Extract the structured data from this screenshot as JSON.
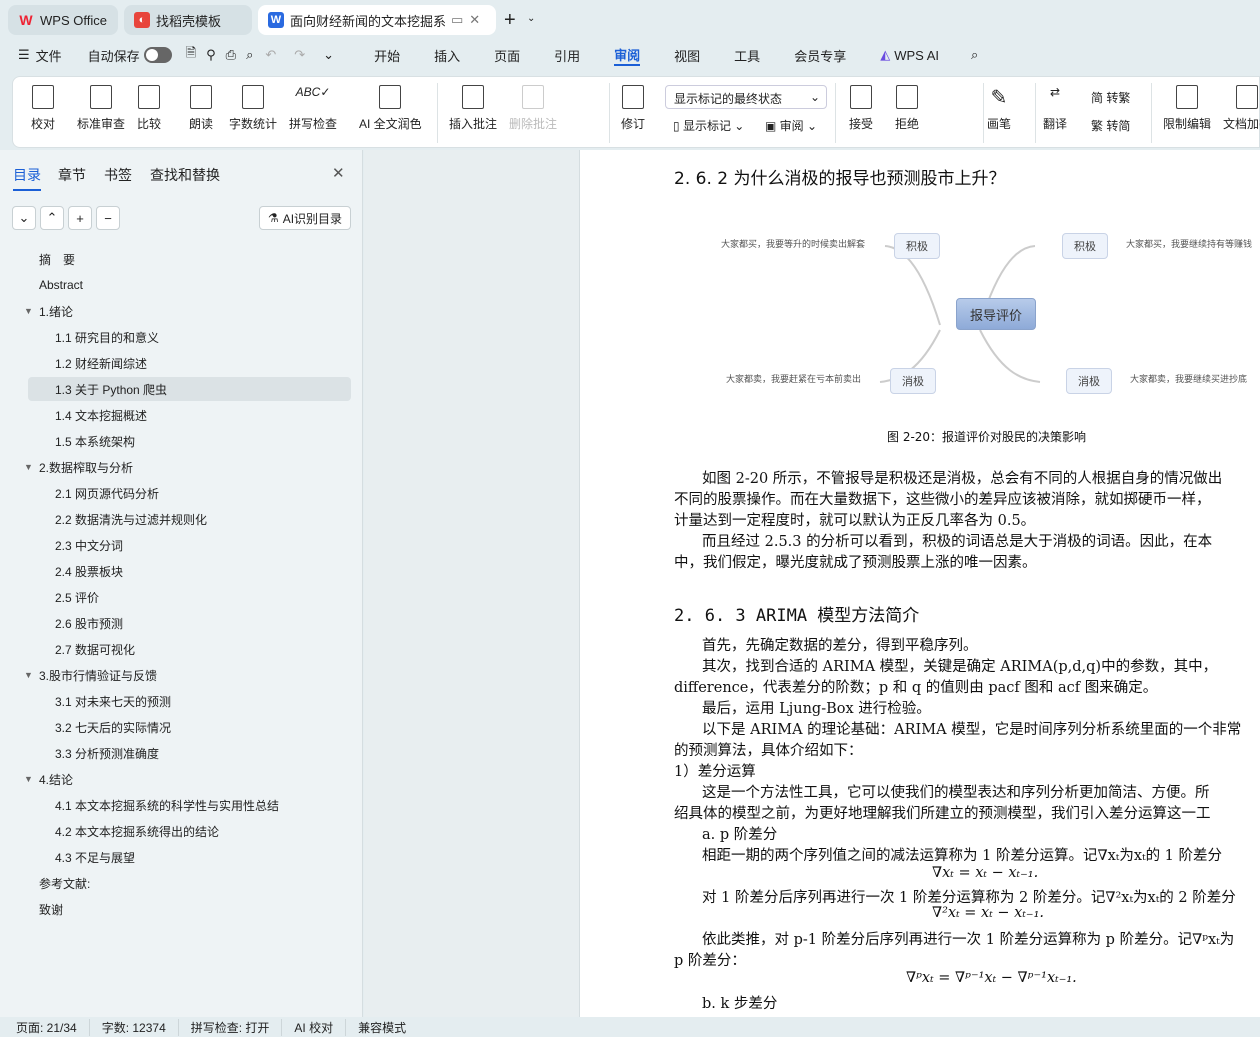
{
  "tabs": [
    {
      "label": "WPS Office"
    },
    {
      "label": "找稻壳模板"
    },
    {
      "label": "面向财经新闻的文本挖掘系统"
    }
  ],
  "menu": {
    "file": "文件",
    "autosave": "自动保存",
    "items": [
      "开始",
      "插入",
      "页面",
      "引用",
      "审阅",
      "视图",
      "工具",
      "会员专享",
      "WPS AI"
    ],
    "active": "审阅"
  },
  "ribbon": {
    "buttons": [
      "校对",
      "标准审查",
      "比较",
      "朗读",
      "字数统计",
      "拼写检查",
      "AI 全文润色",
      "插入批注",
      "删除批注",
      "修订",
      "显示标记",
      "审阅",
      "接受",
      "拒绝",
      "画笔",
      "翻译",
      "转繁",
      "转简",
      "限制编辑",
      "文档加密"
    ],
    "markup_select": "显示标记的最终状态"
  },
  "sidebar": {
    "tabs": [
      "目录",
      "章节",
      "书签",
      "查找和替换"
    ],
    "ai_button": "AI识别目录",
    "toc": [
      {
        "label": "摘　要",
        "level": 0
      },
      {
        "label": "Abstract",
        "level": 0
      },
      {
        "label": "1.绪论",
        "level": 0,
        "toggle": true
      },
      {
        "label": "1.1  研究目的和意义",
        "level": 1
      },
      {
        "label": "1.2  财经新闻综述",
        "level": 1
      },
      {
        "label": "1.3  关于 Python 爬虫",
        "level": 1,
        "selected": true
      },
      {
        "label": "1.4  文本挖掘概述",
        "level": 1
      },
      {
        "label": "1.5 本系统架构",
        "level": 1
      },
      {
        "label": "2.数据榨取与分析",
        "level": 0,
        "toggle": true
      },
      {
        "label": "2.1  网页源代码分析",
        "level": 1
      },
      {
        "label": "2.2  数据清洗与过滤并规则化",
        "level": 1
      },
      {
        "label": "2.3  中文分词",
        "level": 1
      },
      {
        "label": "2.4  股票板块",
        "level": 1
      },
      {
        "label": "2.5  评价",
        "level": 1
      },
      {
        "label": "2.6  股市预测",
        "level": 1
      },
      {
        "label": "2.7  数据可视化",
        "level": 1
      },
      {
        "label": "3.股市行情验证与反馈",
        "level": 0,
        "toggle": true
      },
      {
        "label": "3.1  对未来七天的预测",
        "level": 1
      },
      {
        "label": "3.2  七天后的实际情况",
        "level": 1
      },
      {
        "label": "3.3  分析预测准确度",
        "level": 1
      },
      {
        "label": "4.结论",
        "level": 0,
        "toggle": true
      },
      {
        "label": "4.1  本文本挖掘系统的科学性与实用性总结",
        "level": 1
      },
      {
        "label": "4.2  本文本挖掘系统得出的结论",
        "level": 1
      },
      {
        "label": "4.3  不足与展望",
        "level": 1
      },
      {
        "label": "参考文献:",
        "level": 0
      },
      {
        "label": "致谢",
        "level": 0
      }
    ]
  },
  "doc": {
    "h262": "2. 6. 2  为什么消极的报导也预测股市上升？",
    "diagram": {
      "center": "报导评价",
      "tl": "积极",
      "tr": "积极",
      "bl": "消极",
      "br": "消极",
      "tl_text": "大家都买，我要等升的时候卖出解套",
      "tr_text": "大家都买，我要继续持有等赚钱",
      "bl_text": "大家都卖，我要赶紧在亏本前卖出",
      "br_text": "大家都卖，我要继续买进抄底"
    },
    "caption": "图 2-20：报道评价对股民的决策影响",
    "lines": [
      "如图 2-20 所示，不管报导是积极还是消极，总会有不同的人根据自身的情况做出",
      "不同的股票操作。而在大量数据下，这些微小的差异应该被消除，就如掷硬币一样，",
      "计量达到一定程度时，就可以默认为正反几率各为 0.5。",
      "而且经过 2.5.3 的分析可以看到，积极的词语总是大于消极的词语。因此，在本",
      "中，我们假定，曝光度就成了预测股票上涨的唯一因素。"
    ],
    "h263": "2. 6. 3  ARIMA 模型方法简介",
    "lines2": [
      "首先，先确定数据的差分，得到平稳序列。",
      "其次，找到合适的 ARIMA 模型，关键是确定 ARIMA(p,d,q)中的参数，其中，",
      "difference，代表差分的阶数；p 和 q 的值则由 pacf 图和 acf 图来确定。",
      "最后，运用 Ljung-Box 进行检验。",
      "以下是 ARIMA 的理论基础：ARIMA 模型，它是时间序列分析系统里面的一个非常",
      "的预测算法，具体介绍如下：",
      "1）差分运算",
      "这是一个方法性工具，它可以使我们的模型表达和序列分析更加简洁、方便。所",
      "绍具体的模型之前，为更好地理解我们所建立的预测模型，我们引入差分运算这一工",
      "a.  p 阶差分",
      "相距一期的两个序列值之间的减法运算称为 1 阶差分运算。记∇xₜ为xₜ的 1 阶差分",
      "∇xₜ = xₜ − xₜ₋₁.",
      "对 1 阶差分后序列再进行一次 1 阶差分运算称为 2 阶差分。记∇²xₜ为xₜ的 2 阶差分",
      "∇²xₜ = xₜ − xₜ₋₁.",
      "依此类推，对 p-1 阶差分后序列再进行一次 1 阶差分运算称为 p 阶差分。记∇ᵖxₜ为",
      "p 阶差分：",
      "∇ᵖxₜ = ∇ᵖ⁻¹xₜ − ∇ᵖ⁻¹xₜ₋₁.",
      "b.  k 步差分"
    ]
  },
  "status": {
    "page": "页面: 21/34",
    "words": "字数: 12374",
    "spell": "拼写检查: 打开",
    "ai": "AI 校对",
    "compat": "兼容模式"
  }
}
